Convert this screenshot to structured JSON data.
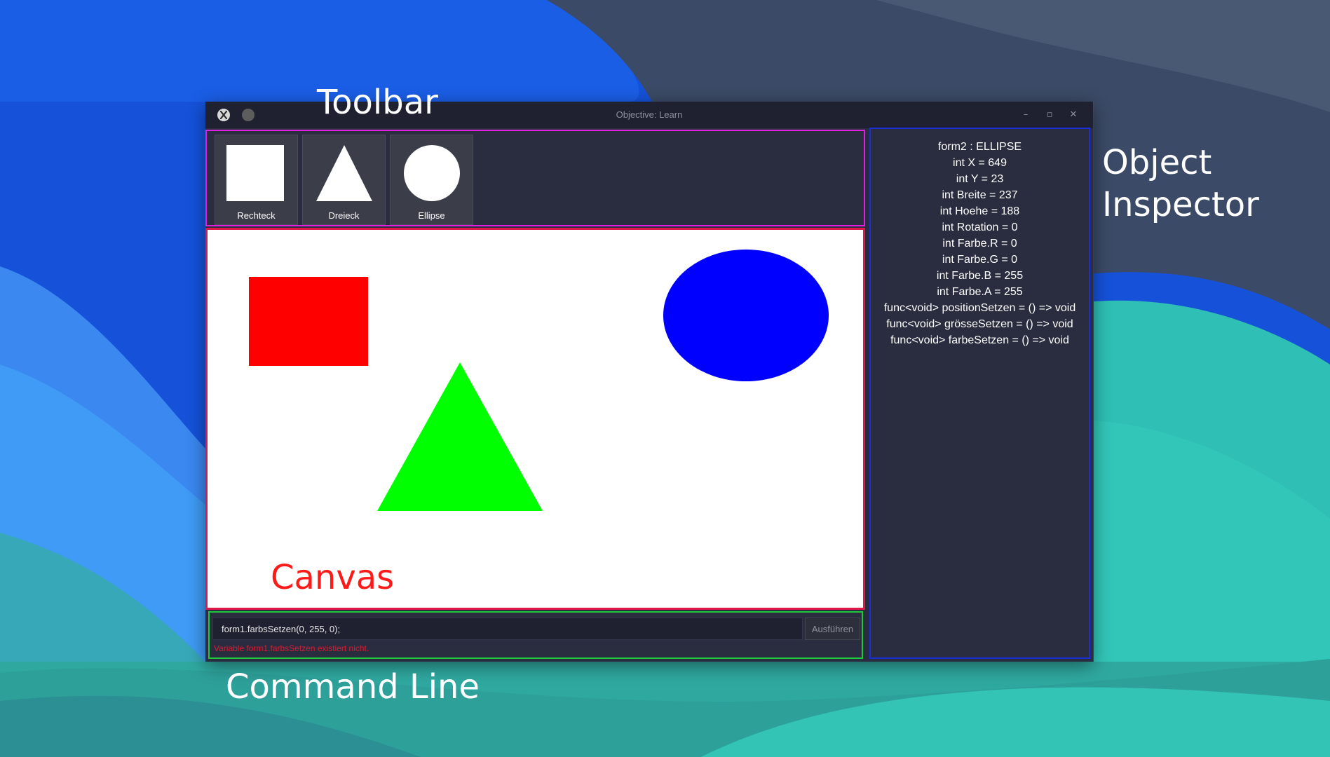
{
  "annotations": {
    "toolbar": "Toolbar",
    "object_inspector": "Object Inspector",
    "command_line": "Command Line",
    "canvas": "Canvas"
  },
  "window": {
    "title": "Objective: Learn",
    "minimize_icon": "minimize-icon",
    "maximize_icon": "maximize-icon",
    "close_icon": "close-icon"
  },
  "toolbar": {
    "tools": [
      {
        "label": "Rechteck",
        "icon": "rectangle-icon"
      },
      {
        "label": "Dreieck",
        "icon": "triangle-icon"
      },
      {
        "label": "Ellipse",
        "icon": "ellipse-icon"
      }
    ]
  },
  "canvas": {
    "shapes": [
      {
        "type": "rectangle",
        "color": "#ff0000"
      },
      {
        "type": "triangle",
        "color": "#00ff00"
      },
      {
        "type": "ellipse",
        "color": "#0000ff"
      }
    ]
  },
  "command_line": {
    "value": "form1.farbsSetzen(0, 255, 0);",
    "run_label": "Ausführen",
    "error": "Variable form1.farbsSetzen existiert nicht."
  },
  "inspector": {
    "title": "form2 : ELLIPSE",
    "lines": [
      "int X = 649",
      "int Y = 23",
      "int Breite = 237",
      "int Hoehe = 188",
      "int Rotation = 0",
      "int Farbe.R = 0",
      "int Farbe.G = 0",
      "int Farbe.B = 255",
      "int Farbe.A = 255",
      "func<void> positionSetzen = () => void",
      "func<void> grösseSetzen = () => void",
      "func<void> farbeSetzen = () => void"
    ]
  },
  "colors": {
    "toolbar_border": "#e020e0",
    "canvas_border": "#e0184a",
    "command_border": "#1ec83a",
    "inspector_border": "#1a2fd8",
    "error_text": "#e0192f",
    "panel_bg": "#2a2d40"
  }
}
